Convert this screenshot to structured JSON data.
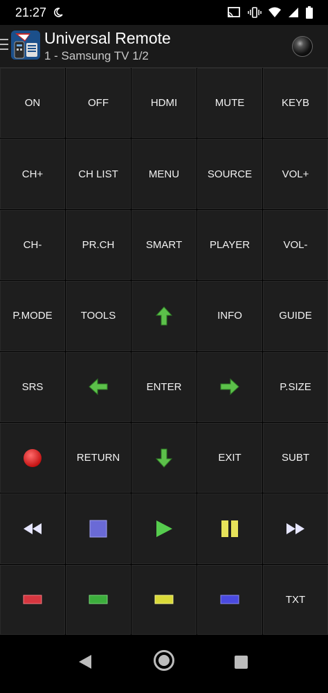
{
  "status": {
    "time": "21:27"
  },
  "app": {
    "title": "Universal Remote",
    "subtitle": "1 - Samsung TV 1/2"
  },
  "buttons": {
    "on": "ON",
    "off": "OFF",
    "hdmi": "HDMI",
    "mute": "MUTE",
    "keyb": "KEYB",
    "ch_plus": "CH+",
    "ch_list": "CH LIST",
    "menu": "MENU",
    "source": "SOURCE",
    "vol_plus": "VOL+",
    "ch_minus": "CH-",
    "prch": "PR.CH",
    "smart": "SMART",
    "player": "PLAYER",
    "vol_minus": "VOL-",
    "pmode": "P.MODE",
    "tools": "TOOLS",
    "info": "INFO",
    "guide": "GUIDE",
    "srs": "SRS",
    "enter": "ENTER",
    "psize": "P.SIZE",
    "return": "RETURN",
    "exit": "EXIT",
    "subt": "SUBT",
    "txt": "TXT"
  },
  "colors": {
    "arrow": "#5cc14a",
    "record": "#e22222",
    "stop": "#6a6ad6",
    "play": "#56cc4e",
    "pause": "#e6e25a",
    "red": "#d6363f",
    "green": "#3cae3c",
    "yellow": "#dada38",
    "blue": "#4a4ae0"
  }
}
